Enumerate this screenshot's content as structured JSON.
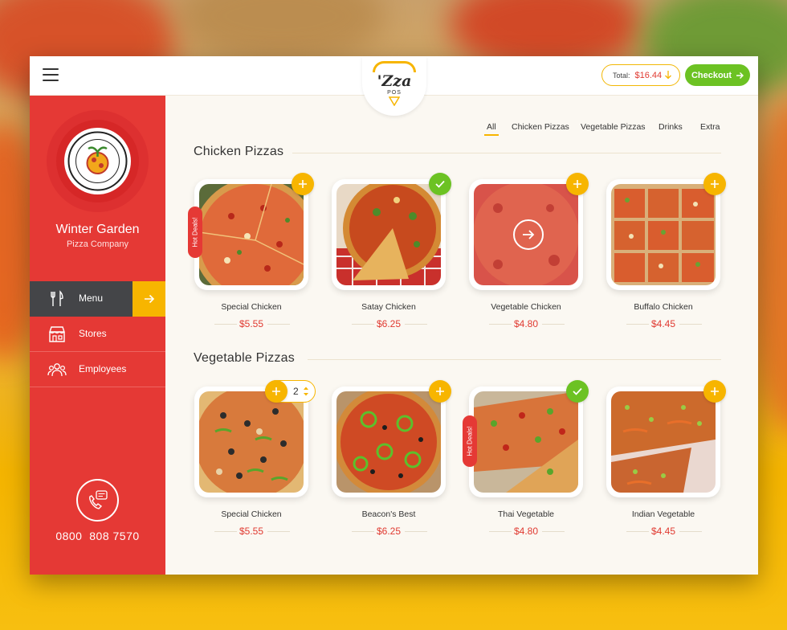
{
  "header": {
    "logo_text": "'Zza",
    "logo_sub": "POS",
    "total_label": "Total:",
    "total_amount": "$16.44",
    "checkout_label": "Checkout"
  },
  "brand": {
    "name": "Winter Garden",
    "subtitle": "Pizza Company"
  },
  "sidebar": {
    "items": [
      {
        "label": "Menu",
        "active": true
      },
      {
        "label": "Stores",
        "active": false
      },
      {
        "label": "Employees",
        "active": false
      }
    ],
    "phone": "0800  808 7570"
  },
  "filters": [
    {
      "label": "All",
      "active": true
    },
    {
      "label": "Chicken Pizzas",
      "active": false
    },
    {
      "label": "Vegetable Pizzas",
      "active": false
    },
    {
      "label": "Drinks",
      "active": false
    },
    {
      "label": "Extra",
      "active": false
    }
  ],
  "sections": [
    {
      "title": "Chicken Pizzas",
      "products": [
        {
          "name": "Special Chicken",
          "price": "$5.55",
          "badge": "add",
          "hot_label": "Hot Deals!"
        },
        {
          "name": "Satay Chicken",
          "price": "$6.25",
          "badge": "selected"
        },
        {
          "name": "Vegetable Chicken",
          "price": "$4.80",
          "badge": "add"
        },
        {
          "name": "Buffalo Chicken",
          "price": "$4.45",
          "badge": "add"
        }
      ]
    },
    {
      "title": "Vegetable Pizzas",
      "products": [
        {
          "name": "Special Chicken",
          "price": "$5.55",
          "badge": "quantity",
          "quantity": "2"
        },
        {
          "name": "Beacon's Best",
          "price": "$6.25",
          "badge": "add"
        },
        {
          "name": "Thai Vegetable",
          "price": "$4.80",
          "badge": "selected",
          "hot_label": "Hot Deals!"
        },
        {
          "name": "Indian Vegetable",
          "price": "$4.45",
          "badge": "add"
        }
      ]
    }
  ],
  "colors": {
    "primary_red": "#e53935",
    "accent_yellow": "#f7b500",
    "success_green": "#6cc223",
    "dark_nav": "#444548"
  }
}
